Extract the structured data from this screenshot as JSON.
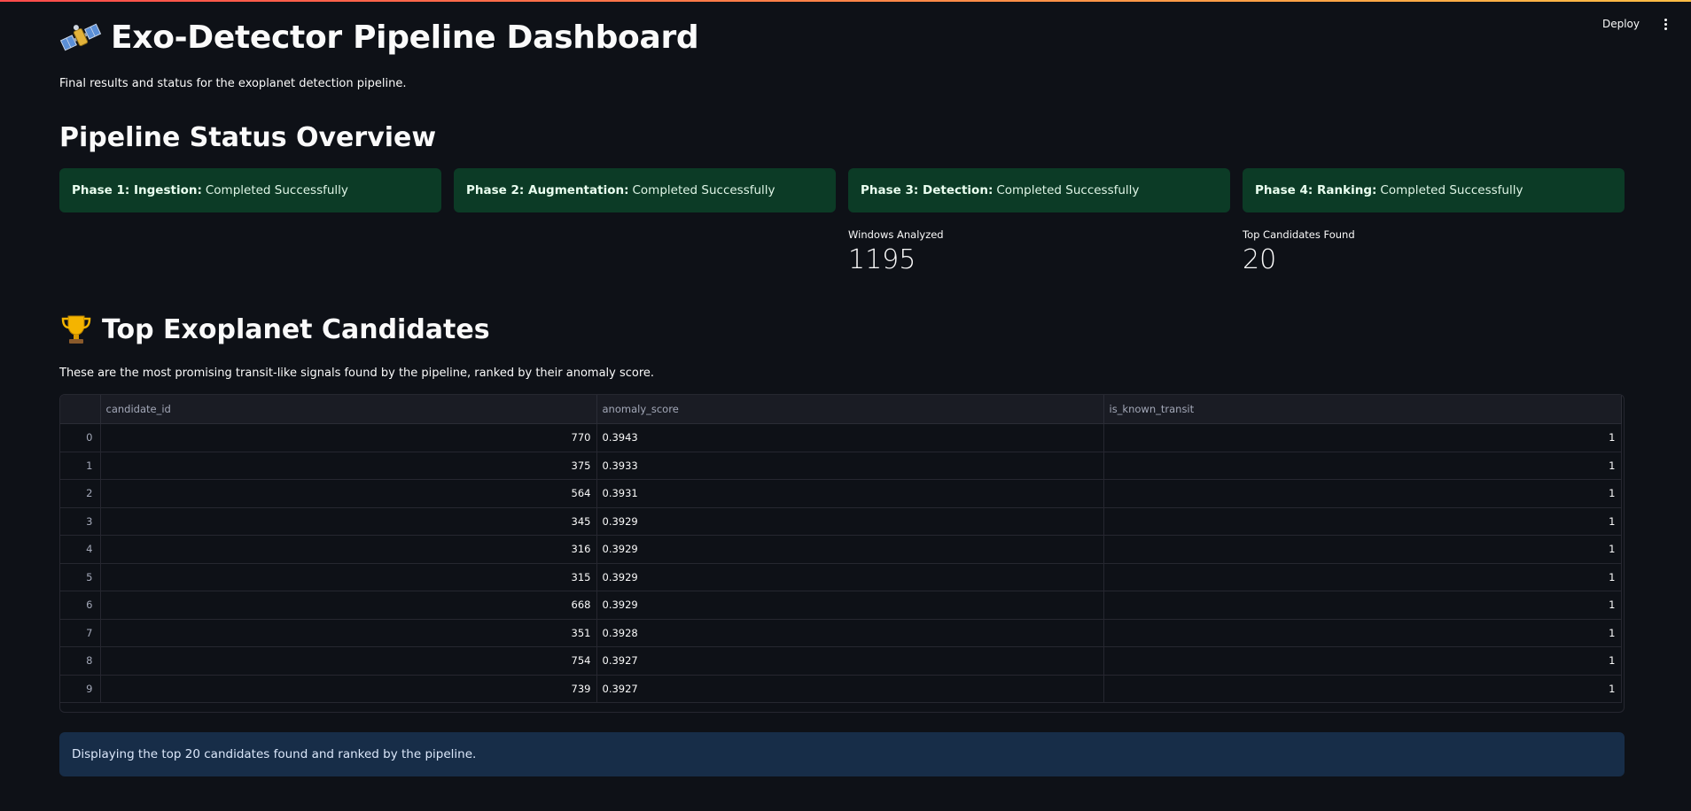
{
  "header": {
    "deploy_label": "Deploy"
  },
  "page": {
    "title": "Exo-Detector Pipeline Dashboard",
    "subtitle": "Final results and status for the exoplanet detection pipeline.",
    "title_icon": "satellite-icon"
  },
  "status": {
    "title": "Pipeline Status Overview",
    "cards": [
      {
        "phase": "Phase 1: Ingestion:",
        "status": "Completed Successfully"
      },
      {
        "phase": "Phase 2: Augmentation:",
        "status": "Completed Successfully"
      },
      {
        "phase": "Phase 3: Detection:",
        "status": "Completed Successfully"
      },
      {
        "phase": "Phase 4: Ranking:",
        "status": "Completed Successfully"
      }
    ],
    "metrics": [
      {
        "label": "Windows Analyzed",
        "value": "1195"
      },
      {
        "label": "Top Candidates Found",
        "value": "20"
      }
    ]
  },
  "candidates": {
    "title": "Top Exoplanet Candidates",
    "title_icon": "trophy-icon",
    "description": "These are the most promising transit-like signals found by the pipeline, ranked by their anomaly score.",
    "columns": [
      "",
      "candidate_id",
      "anomaly_score",
      "is_known_transit"
    ],
    "rows": [
      [
        "0",
        "770",
        "0.3943",
        "1"
      ],
      [
        "1",
        "375",
        "0.3933",
        "1"
      ],
      [
        "2",
        "564",
        "0.3931",
        "1"
      ],
      [
        "3",
        "345",
        "0.3929",
        "1"
      ],
      [
        "4",
        "316",
        "0.3929",
        "1"
      ],
      [
        "5",
        "315",
        "0.3929",
        "1"
      ],
      [
        "6",
        "668",
        "0.3929",
        "1"
      ],
      [
        "7",
        "351",
        "0.3928",
        "1"
      ],
      [
        "8",
        "754",
        "0.3927",
        "1"
      ],
      [
        "9",
        "739",
        "0.3927",
        "1"
      ]
    ],
    "info": "Displaying the top 20 candidates found and ranked by the pipeline."
  }
}
